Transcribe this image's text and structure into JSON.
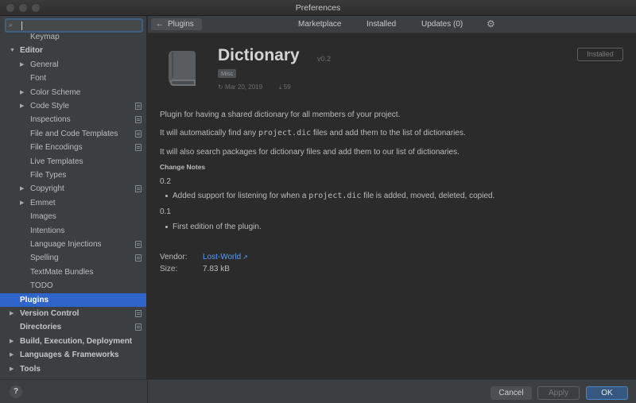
{
  "window": {
    "title": "Preferences"
  },
  "sidebar": {
    "search": {
      "value": "",
      "placeholder": ""
    },
    "items": [
      {
        "label": "Keymap",
        "depth": 1,
        "arrow": false,
        "bold": false,
        "proj": false,
        "selected": false,
        "interactable": true
      },
      {
        "label": "Editor",
        "depth": 0,
        "arrow": "open",
        "bold": true,
        "proj": false,
        "selected": false,
        "interactable": true
      },
      {
        "label": "General",
        "depth": 1,
        "arrow": "closed",
        "bold": false,
        "proj": false,
        "selected": false,
        "interactable": true
      },
      {
        "label": "Font",
        "depth": 1,
        "arrow": false,
        "bold": false,
        "proj": false,
        "selected": false,
        "interactable": true
      },
      {
        "label": "Color Scheme",
        "depth": 1,
        "arrow": "closed",
        "bold": false,
        "proj": false,
        "selected": false,
        "interactable": true
      },
      {
        "label": "Code Style",
        "depth": 1,
        "arrow": "closed",
        "bold": false,
        "proj": true,
        "selected": false,
        "interactable": true
      },
      {
        "label": "Inspections",
        "depth": 1,
        "arrow": false,
        "bold": false,
        "proj": true,
        "selected": false,
        "interactable": true
      },
      {
        "label": "File and Code Templates",
        "depth": 1,
        "arrow": false,
        "bold": false,
        "proj": true,
        "selected": false,
        "interactable": true
      },
      {
        "label": "File Encodings",
        "depth": 1,
        "arrow": false,
        "bold": false,
        "proj": true,
        "selected": false,
        "interactable": true
      },
      {
        "label": "Live Templates",
        "depth": 1,
        "arrow": false,
        "bold": false,
        "proj": false,
        "selected": false,
        "interactable": true
      },
      {
        "label": "File Types",
        "depth": 1,
        "arrow": false,
        "bold": false,
        "proj": false,
        "selected": false,
        "interactable": true
      },
      {
        "label": "Copyright",
        "depth": 1,
        "arrow": "closed",
        "bold": false,
        "proj": true,
        "selected": false,
        "interactable": true
      },
      {
        "label": "Emmet",
        "depth": 1,
        "arrow": "closed",
        "bold": false,
        "proj": false,
        "selected": false,
        "interactable": true
      },
      {
        "label": "Images",
        "depth": 1,
        "arrow": false,
        "bold": false,
        "proj": false,
        "selected": false,
        "interactable": true
      },
      {
        "label": "Intentions",
        "depth": 1,
        "arrow": false,
        "bold": false,
        "proj": false,
        "selected": false,
        "interactable": true
      },
      {
        "label": "Language Injections",
        "depth": 1,
        "arrow": false,
        "bold": false,
        "proj": true,
        "selected": false,
        "interactable": true
      },
      {
        "label": "Spelling",
        "depth": 1,
        "arrow": false,
        "bold": false,
        "proj": true,
        "selected": false,
        "interactable": true
      },
      {
        "label": "TextMate Bundles",
        "depth": 1,
        "arrow": false,
        "bold": false,
        "proj": false,
        "selected": false,
        "interactable": true
      },
      {
        "label": "TODO",
        "depth": 1,
        "arrow": false,
        "bold": false,
        "proj": false,
        "selected": false,
        "interactable": true
      },
      {
        "label": "Plugins",
        "depth": 0,
        "arrow": false,
        "bold": true,
        "proj": false,
        "selected": true,
        "interactable": true
      },
      {
        "label": "Version Control",
        "depth": 0,
        "arrow": "closed",
        "bold": true,
        "proj": true,
        "selected": false,
        "interactable": true
      },
      {
        "label": "Directories",
        "depth": 0,
        "arrow": false,
        "bold": true,
        "proj": true,
        "selected": false,
        "interactable": true
      },
      {
        "label": "Build, Execution, Deployment",
        "depth": 0,
        "arrow": "closed",
        "bold": true,
        "proj": false,
        "selected": false,
        "interactable": true
      },
      {
        "label": "Languages & Frameworks",
        "depth": 0,
        "arrow": "closed",
        "bold": true,
        "proj": false,
        "selected": false,
        "interactable": true
      },
      {
        "label": "Tools",
        "depth": 0,
        "arrow": "closed",
        "bold": true,
        "proj": false,
        "selected": false,
        "interactable": true
      }
    ],
    "help_label": "?"
  },
  "topbar": {
    "back_label": "Plugins",
    "tabs": {
      "marketplace": "Marketplace",
      "installed": "Installed",
      "updates": "Updates (0)"
    }
  },
  "plugin": {
    "name": "Dictionary",
    "version": "v0.2",
    "category": "Misc",
    "date": "Mar 20, 2019",
    "downloads": "59",
    "status_button": "Installed",
    "description": [
      {
        "before": "Plugin for having a shared dictionary for all members of your project.",
        "code": "",
        "after": ""
      },
      {
        "before": "It will automatically find any ",
        "code": "project.dic",
        "after": " files and add them to the list of dictionaries."
      },
      {
        "before": "It will also search packages for dictionary files and add them to our list of dictionaries.",
        "code": "",
        "after": ""
      }
    ],
    "change_notes_heading": "Change Notes",
    "changes": [
      {
        "version": "0.2",
        "bullet_before": "Added support for listening for when a ",
        "bullet_code": "project.dic",
        "bullet_after": " file is added, moved, deleted, copied."
      },
      {
        "version": "0.1",
        "bullet_before": "First edition of the plugin.",
        "bullet_code": "",
        "bullet_after": ""
      }
    ],
    "vendor_label": "Vendor:",
    "vendor_value": "Lost-World",
    "size_label": "Size:",
    "size_value": "7.83 kB"
  },
  "footer": {
    "cancel": "Cancel",
    "apply": "Apply",
    "ok": "OK"
  },
  "colors": {
    "accent": "#2f65ca",
    "link": "#589df6",
    "ok_button": "#365880",
    "background": "#2b2b2b",
    "sidebar": "#3c3f41"
  }
}
